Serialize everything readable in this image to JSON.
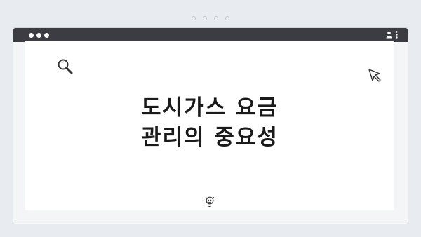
{
  "browser": {
    "icons": [
      "search-icon",
      "cursor-icon",
      "user-icon",
      "more-vertical-icon",
      "lightbulb-icon"
    ]
  },
  "headline": {
    "line1": "도시가스 요금",
    "line2": "관리의 중요성"
  },
  "colors": {
    "page_background": "#e8ebef",
    "titlebar": "#3b3d42",
    "content_background": "#ffffff",
    "text": "#1a1a1a"
  }
}
